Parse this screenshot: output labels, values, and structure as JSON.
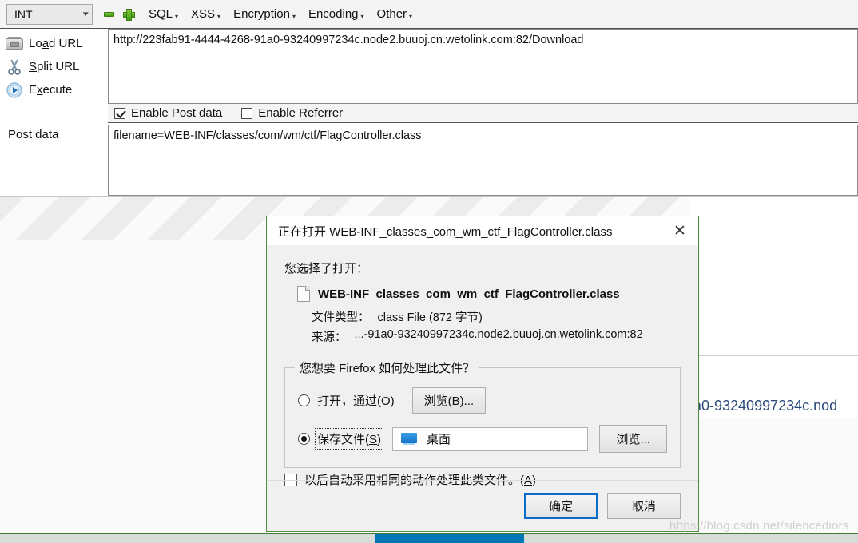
{
  "hackbar": {
    "type_select": {
      "value": "INT",
      "chevron": "chevron-down-icon"
    },
    "icons": {
      "remove": "minus-icon",
      "add": "plus-icon"
    },
    "menus": [
      {
        "label": "SQL",
        "caret": "▾"
      },
      {
        "label": "XSS",
        "caret": "▾"
      },
      {
        "label": "Encryption",
        "caret": "▾"
      },
      {
        "label": "Encoding",
        "caret": "▾"
      },
      {
        "label": "Other",
        "caret": "▾"
      }
    ],
    "actions": [
      {
        "icon": "load-url-icon",
        "pre": "Lo",
        "key": "a",
        "post": "d URL"
      },
      {
        "icon": "split-url-icon",
        "pre": "",
        "key": "S",
        "post": "plit URL"
      },
      {
        "icon": "execute-icon",
        "pre": "E",
        "key": "x",
        "post": "ecute"
      }
    ],
    "url_value": "http://223fab91-4444-4268-91a0-93240997234c.node2.buuoj.cn.wetolink.com:82/Download",
    "enable_post_label": "Enable Post data",
    "enable_post_checked": true,
    "enable_referrer_label": "Enable Referrer",
    "enable_referrer_checked": false,
    "post_data_label": "Post data",
    "post_data_value": "filename=WEB-INF/classes/com/wm/ctf/FlagController.class"
  },
  "background": {
    "partial_text": "a0-93240997234c.nod",
    "watermark": "https://blog.csdn.net/silencediors"
  },
  "dialog": {
    "title": "正在打开 WEB-INF_classes_com_wm_ctf_FlagController.class",
    "close_icon": "close-icon",
    "lead": "您选择了打开：",
    "file_icon": "file-icon",
    "file_name": "WEB-INF_classes_com_wm_ctf_FlagController.class",
    "meta": [
      {
        "key": "文件类型：",
        "value": "class File (872 字节)"
      },
      {
        "key": "来源：",
        "value": "...-91a0-93240997234c.node2.buuoj.cn.wetolink.com:82"
      }
    ],
    "fieldset_legend": "您想要 Firefox 如何处理此文件？",
    "open_with": {
      "label": "打开，通过(O)",
      "selected": false,
      "browse_label": "浏览(B)..."
    },
    "save_file": {
      "label": "保存文件(S)",
      "selected": true,
      "path_icon": "desktop-monitor-icon",
      "path_value": "桌面",
      "browse_label": "浏览..."
    },
    "auto_checkbox": {
      "label": "以后自动采用相同的动作处理此类文件。(A)",
      "checked": false
    },
    "ok_label": "确定",
    "cancel_label": "取消"
  },
  "colors": {
    "dialog_border": "#4f8f3f",
    "primary_focus": "#0a6cc7",
    "accent_green": "#3f9f10",
    "taskbar_blue": "#0277b5"
  }
}
